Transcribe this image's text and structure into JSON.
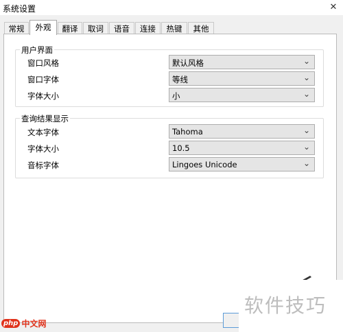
{
  "window": {
    "title": "系统设置",
    "close_glyph": "✕"
  },
  "tabs": [
    {
      "label": "常规"
    },
    {
      "label": "外观",
      "active": true
    },
    {
      "label": "翻译"
    },
    {
      "label": "取词"
    },
    {
      "label": "语音"
    },
    {
      "label": "连接"
    },
    {
      "label": "热键"
    },
    {
      "label": "其他"
    }
  ],
  "ui_group": {
    "title": "用户界面",
    "rows": [
      {
        "label": "窗口风格",
        "value": "默认风格"
      },
      {
        "label": "窗口字体",
        "value": "等线"
      },
      {
        "label": "字体大小",
        "value": "小"
      }
    ]
  },
  "result_group": {
    "title": "查询结果显示",
    "rows": [
      {
        "label": "文本字体",
        "value": "Tahoma"
      },
      {
        "label": "字体大小",
        "value": "10.5"
      },
      {
        "label": "音标字体",
        "value": "Lingoes Unicode"
      }
    ]
  },
  "icons": {
    "combo_arrow": "chevron-down-icon",
    "pen": "pen-icon"
  },
  "watermark": {
    "text": "软件技巧",
    "logo_badge": "php",
    "logo_text": "中文网"
  },
  "colors": {
    "tab_border": "#a6a6a6",
    "combo_bg": "#e5e5e5",
    "php_red": "#e0321b"
  }
}
